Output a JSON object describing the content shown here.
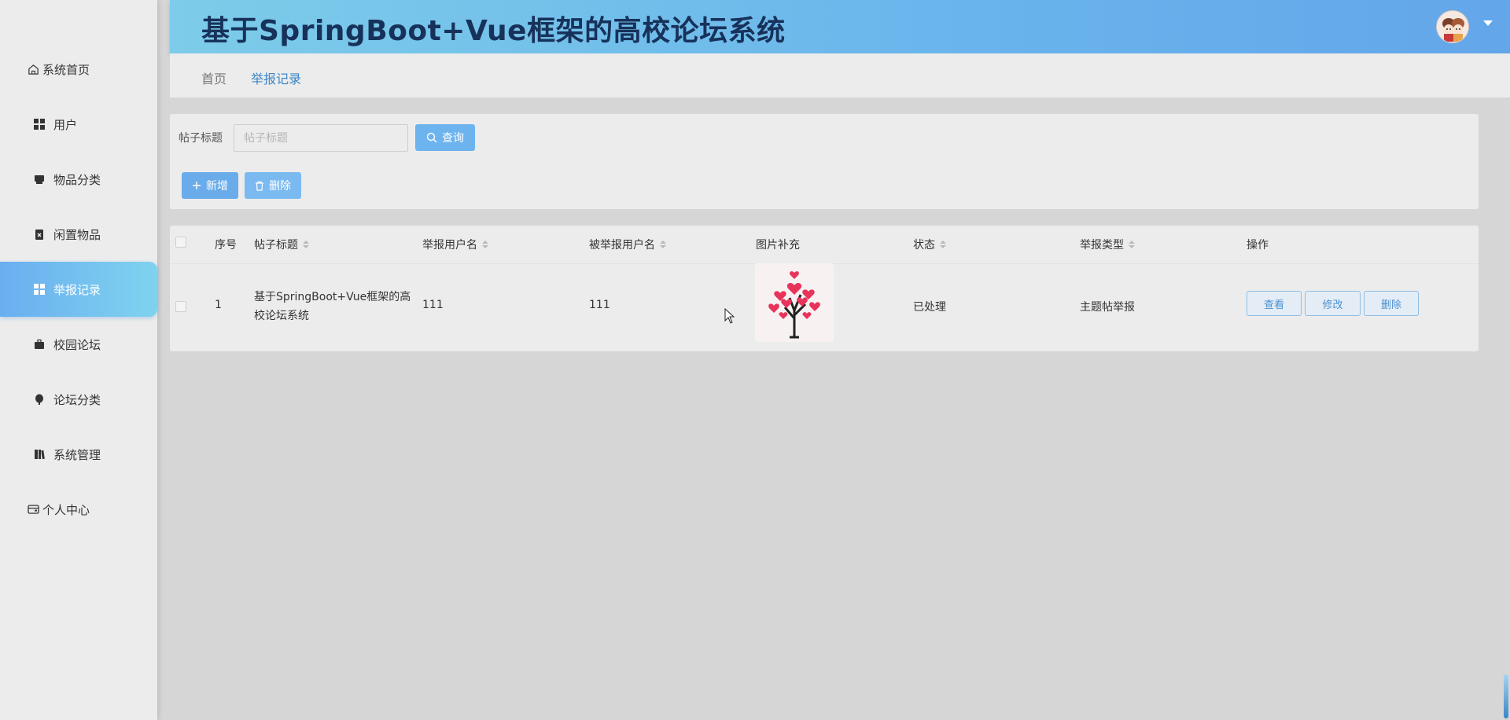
{
  "header": {
    "title": "基于SpringBoot+Vue框架的高校论坛系统"
  },
  "sidebar": {
    "items": [
      {
        "label": "系统首页",
        "icon": "home-icon"
      },
      {
        "label": "用户",
        "icon": "grid-icon"
      },
      {
        "label": "物品分类",
        "icon": "box-icon"
      },
      {
        "label": "闲置物品",
        "icon": "clipboard-icon"
      },
      {
        "label": "举报记录",
        "icon": "grid-icon",
        "active": true
      },
      {
        "label": "校园论坛",
        "icon": "briefcase-icon"
      },
      {
        "label": "论坛分类",
        "icon": "pin-icon"
      },
      {
        "label": "系统管理",
        "icon": "book-icon"
      },
      {
        "label": "个人中心",
        "icon": "wallet-icon"
      }
    ]
  },
  "breadcrumb": {
    "home": "首页",
    "current": "举报记录"
  },
  "search": {
    "label": "帖子标题",
    "placeholder": "帖子标题",
    "query_label": "查询",
    "add_label": "新增",
    "delete_label": "删除"
  },
  "table": {
    "columns": [
      "序号",
      "帖子标题",
      "举报用户名",
      "被举报用户名",
      "图片补充",
      "状态",
      "举报类型",
      "操作"
    ],
    "rows": [
      {
        "index": "1",
        "title_line1": "基于SpringBoot+Vue框架的高",
        "title_line2": "校论坛系统",
        "reporter": "111",
        "reported": "111",
        "status": "已处理",
        "type": "主题帖举报",
        "actions": {
          "view": "查看",
          "edit": "修改",
          "delete": "删除"
        }
      }
    ]
  },
  "colors": {
    "header_start": "#7dcce9",
    "header_end": "#63a6ea",
    "title": "#17325a",
    "accent": "#6aacea",
    "active_menu": "#6aaef0"
  }
}
